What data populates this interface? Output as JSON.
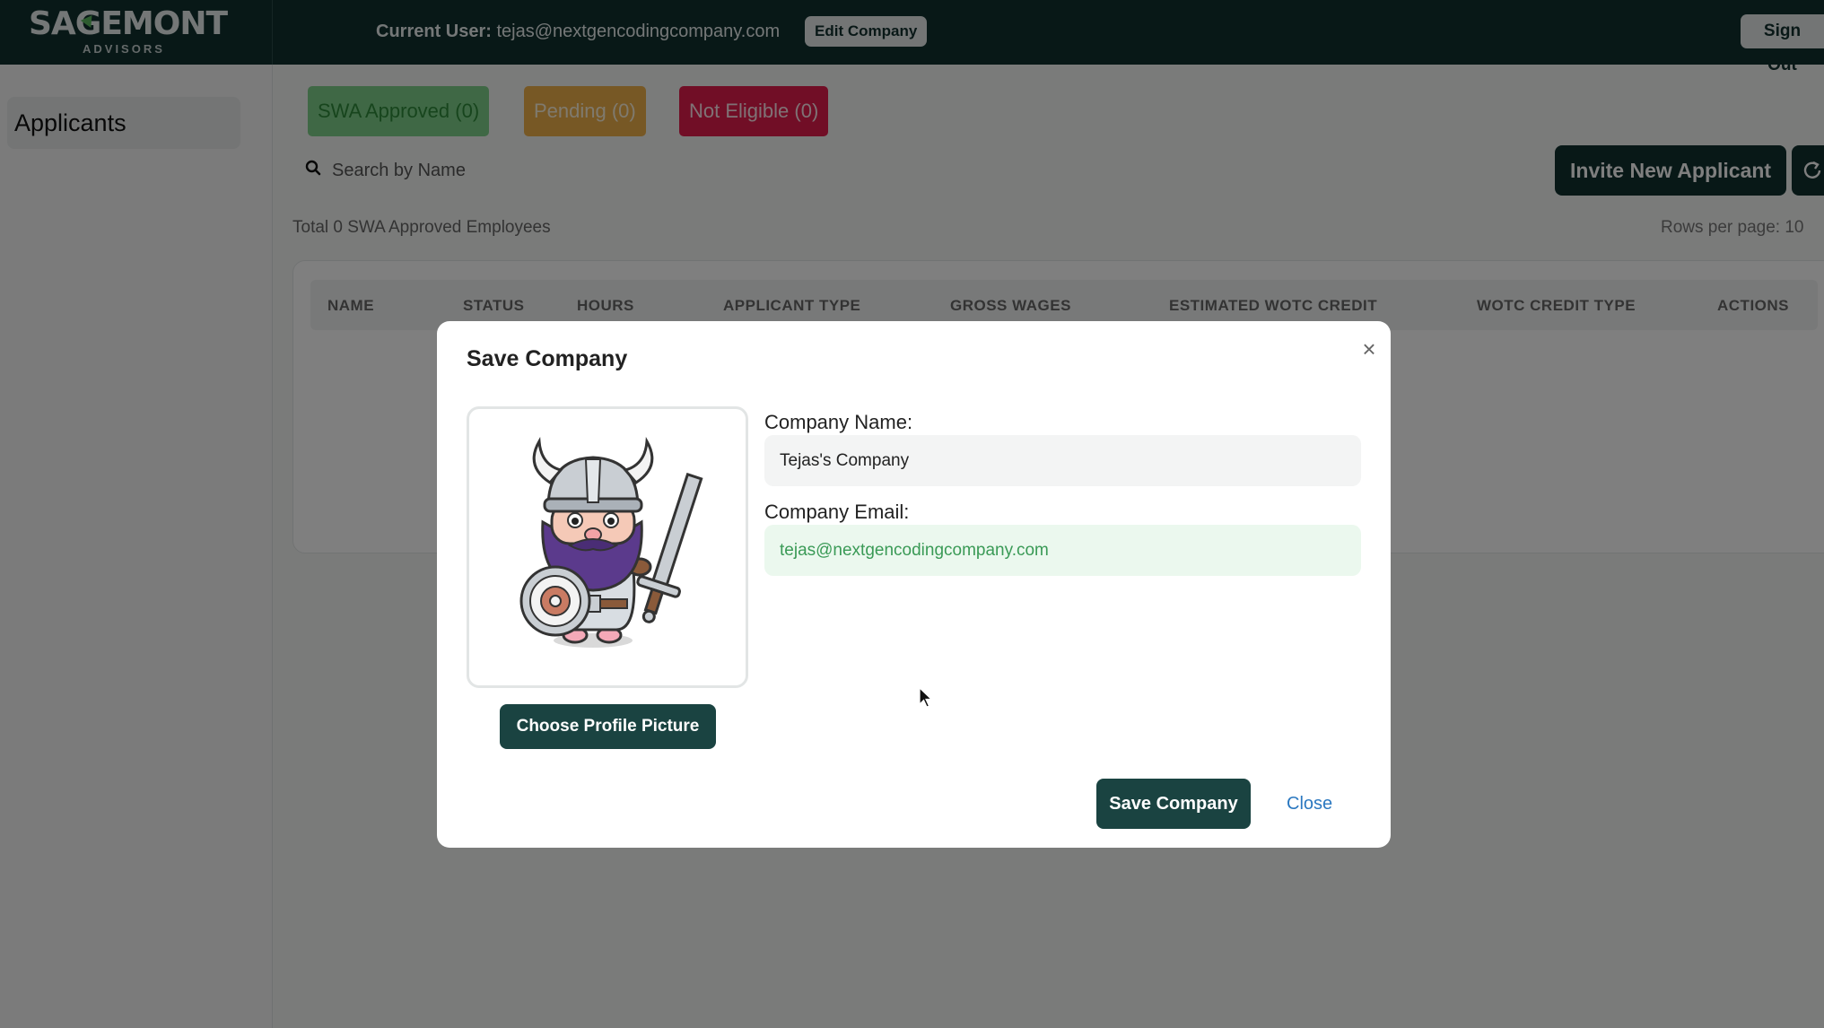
{
  "brand": {
    "name": "SAGEMONT",
    "sub": "ADVISORS"
  },
  "header": {
    "current_user_label": "Current User:",
    "current_user_email": "tejas@nextgencodingcompany.com",
    "edit_company_label": "Edit Company",
    "sign_out_label": "Sign Out"
  },
  "sidebar": {
    "items": [
      {
        "label": "Applicants"
      }
    ]
  },
  "filters": {
    "approved": "SWA Approved (0)",
    "pending": "Pending (0)",
    "not_eligible": "Not Eligible (0)"
  },
  "search": {
    "placeholder": "Search by Name"
  },
  "toolbar": {
    "invite_label": "Invite New Applicant"
  },
  "summary": {
    "total_text": "Total 0 SWA Approved Employees",
    "rows_per_page": "Rows per page: 10"
  },
  "table": {
    "columns": [
      "NAME",
      "STATUS",
      "HOURS",
      "APPLICANT TYPE",
      "GROSS WAGES",
      "ESTIMATED WOTC CREDIT",
      "WOTC CREDIT TYPE",
      "ACTIONS"
    ]
  },
  "modal": {
    "title": "Save Company",
    "close_icon": "×",
    "choose_picture_label": "Choose Profile Picture",
    "company_name_label": "Company Name:",
    "company_name_value": "Tejas's Company",
    "company_email_label": "Company Email:",
    "company_email_value": "tejas@nextgencodingcompany.com",
    "save_label": "Save Company",
    "close_label": "Close"
  },
  "colors": {
    "topbar": "#10302f",
    "primary_button": "#1a4341",
    "approved": "#7fd08a",
    "pending": "#efb04a",
    "not_eligible": "#e21c4d",
    "link": "#2b78c0"
  },
  "icons": [
    "search-icon",
    "refresh-icon",
    "close-icon",
    "viking-avatar-icon",
    "mouse-cursor-icon"
  ]
}
